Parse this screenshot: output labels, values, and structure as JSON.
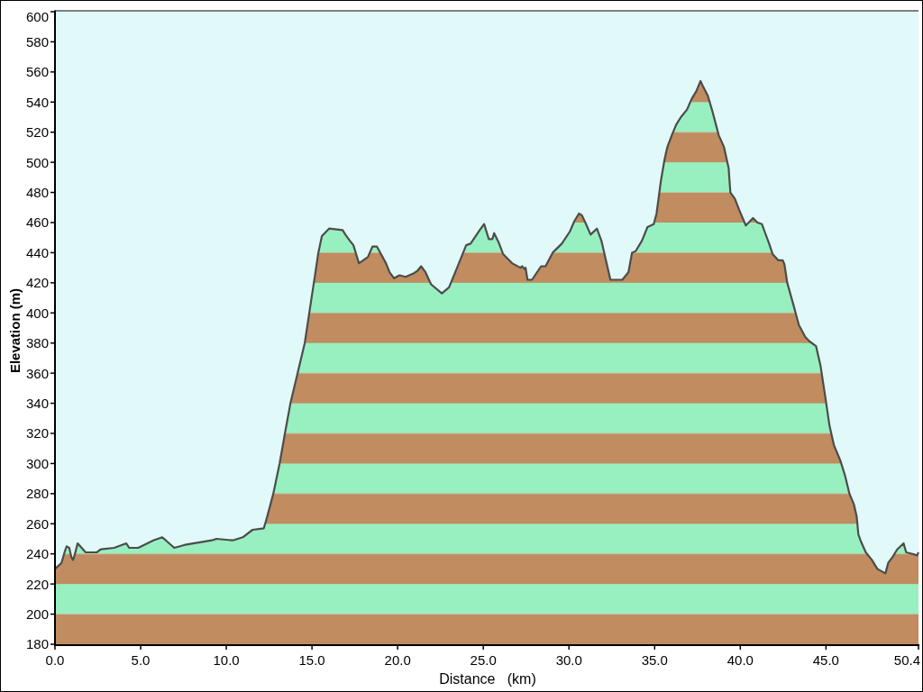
{
  "chart_data": {
    "type": "area",
    "xlabel": "Distance   (km)",
    "ylabel": "Elevation (m)",
    "x": [
      0,
      0.38,
      0.56,
      0.68,
      0.83,
      0.95,
      1.05,
      1.17,
      1.32,
      1.79,
      2.44,
      2.67,
      3.46,
      4.16,
      4.33,
      4.86,
      5.74,
      6.26,
      6.47,
      6.96,
      7.58,
      9.16,
      9.42,
      10.38,
      10.96,
      11.53,
      12.19,
      12.37,
      12.58,
      12.74,
      13.11,
      13.42,
      13.74,
      14.16,
      14.58,
      14.84,
      15.11,
      15.37,
      15.58,
      16.0,
      16.79,
      16.95,
      17.21,
      17.42,
      17.74,
      18.26,
      18.53,
      18.79,
      19.32,
      19.53,
      19.79,
      20.11,
      20.47,
      20.89,
      21.16,
      21.37,
      21.63,
      21.95,
      22.58,
      23.0,
      23.47,
      24.0,
      24.26,
      24.79,
      25.05,
      25.32,
      25.53,
      25.63,
      25.89,
      26.16,
      26.68,
      27.16,
      27.26,
      27.42,
      27.47,
      27.58,
      27.84,
      28.37,
      28.63,
      29.05,
      29.58,
      30.05,
      30.32,
      30.58,
      30.74,
      31.0,
      31.26,
      31.63,
      31.89,
      32.42,
      33.11,
      33.47,
      33.68,
      33.89,
      34.26,
      34.58,
      34.95,
      35.11,
      35.37,
      35.58,
      35.74,
      36.0,
      36.26,
      36.53,
      36.89,
      37.16,
      37.42,
      37.68,
      37.84,
      38.11,
      38.37,
      38.74,
      39.05,
      39.32,
      39.42,
      39.68,
      39.95,
      40.32,
      40.58,
      40.74,
      41.0,
      41.26,
      41.42,
      41.68,
      41.89,
      42.21,
      42.47,
      42.58,
      42.74,
      43.11,
      43.42,
      43.79,
      44.05,
      44.42,
      44.68,
      44.95,
      45.21,
      45.47,
      45.84,
      46.11,
      46.37,
      46.63,
      46.79,
      46.89,
      47.05,
      47.32,
      47.68,
      48.0,
      48.47,
      48.63,
      48.89,
      49.16,
      49.53,
      49.68,
      50.05,
      50.32,
      50.4
    ],
    "values": [
      230,
      234,
      241,
      245,
      244,
      238,
      236,
      240,
      247,
      241,
      241,
      243,
      244,
      247,
      244,
      244,
      249,
      251,
      249,
      244,
      246,
      249,
      250,
      249,
      251,
      256,
      257,
      264,
      273,
      280,
      300,
      320,
      340,
      360,
      380,
      400,
      420,
      440,
      451,
      456,
      455,
      452,
      448,
      445,
      433,
      437,
      444,
      444,
      433,
      427,
      423,
      425,
      424,
      426,
      428,
      431,
      427,
      419,
      413,
      417,
      430,
      445,
      446,
      455,
      459,
      449,
      449,
      453,
      447,
      439,
      433,
      430,
      431,
      429,
      430,
      422,
      422,
      431,
      431,
      440,
      446,
      454,
      461,
      466,
      465,
      459,
      452,
      456,
      448,
      422,
      422,
      427,
      440,
      441,
      448,
      457,
      459,
      466,
      488,
      502,
      510,
      518,
      525,
      530,
      535,
      542,
      547,
      554,
      550,
      544,
      534,
      518,
      510,
      496,
      480,
      476,
      468,
      458,
      461,
      463,
      460,
      459,
      454,
      446,
      439,
      435,
      435,
      432,
      420,
      405,
      392,
      384,
      381,
      378,
      365,
      345,
      325,
      312,
      302,
      292,
      280,
      273,
      265,
      253,
      248,
      241,
      236,
      230,
      227,
      234,
      238,
      243,
      247,
      241,
      240,
      239,
      241
    ],
    "xlim": [
      0,
      50.4
    ],
    "ylim": [
      180,
      600
    ],
    "xticks": [
      {
        "value": 0,
        "label": "0.0"
      },
      {
        "value": 5,
        "label": "5.0"
      },
      {
        "value": 10,
        "label": "10.0"
      },
      {
        "value": 15,
        "label": "15.0"
      },
      {
        "value": 20,
        "label": "20.0"
      },
      {
        "value": 25,
        "label": "25.0"
      },
      {
        "value": 30,
        "label": "30.0"
      },
      {
        "value": 35,
        "label": "35.0"
      },
      {
        "value": 40,
        "label": "40.0"
      },
      {
        "value": 45,
        "label": "45.0"
      },
      {
        "value": 50.4,
        "label": "50.4"
      }
    ],
    "yticks": [
      180,
      200,
      220,
      240,
      260,
      280,
      300,
      320,
      340,
      360,
      380,
      400,
      420,
      440,
      460,
      480,
      500,
      520,
      540,
      560,
      580,
      600
    ]
  }
}
